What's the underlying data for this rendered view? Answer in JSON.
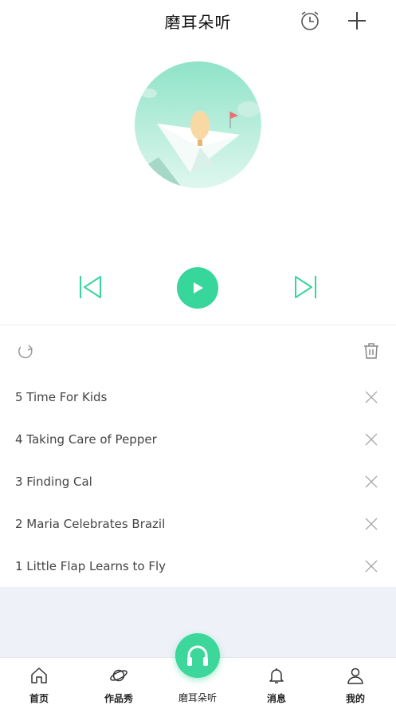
{
  "header": {
    "title": "磨耳朵听",
    "alarm_icon": "alarm-clock-icon",
    "add_icon": "plus-icon"
  },
  "cover": {
    "image": "paper-plane-balloon-illustration"
  },
  "player": {
    "prev_icon": "skip-previous-icon",
    "play_icon": "play-icon",
    "next_icon": "skip-next-icon",
    "accent": "#37d69a"
  },
  "list_tools": {
    "repeat_icon": "repeat-icon",
    "trash_icon": "trash-icon"
  },
  "playlist": {
    "items": [
      {
        "title": "5 Time For Kids"
      },
      {
        "title": "4 Taking Care of Pepper"
      },
      {
        "title": "3 Finding Cal"
      },
      {
        "title": "2 Maria Celebrates Brazil"
      },
      {
        "title": "1 Little Flap Learns to Fly"
      }
    ]
  },
  "tabs": {
    "home": "首页",
    "works": "作品秀",
    "listen": "磨耳朵听",
    "messages": "消息",
    "me": "我的"
  }
}
